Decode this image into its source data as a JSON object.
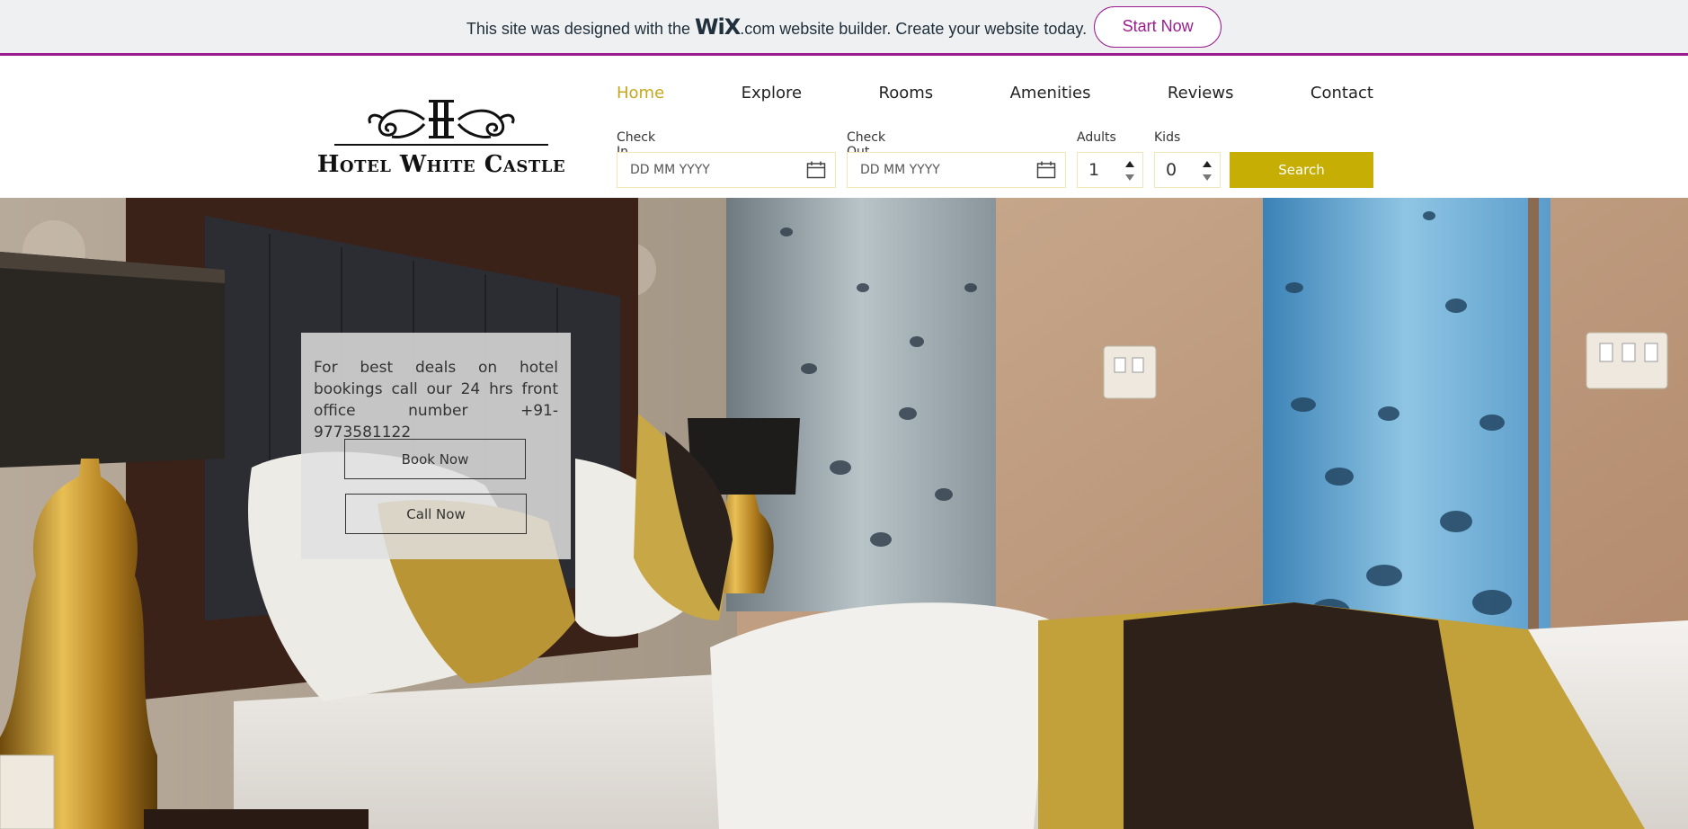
{
  "wix_banner": {
    "prefix": "This site was designed with the",
    "logo": "WiX",
    "logo_suffix": ".com",
    "suffix": "website builder. Create your website today.",
    "start_label": "Start Now",
    "accent_color": "#9b1b8e"
  },
  "logo": {
    "text": "Hotel White Castle"
  },
  "nav": {
    "items": [
      {
        "label": "Home",
        "active": true
      },
      {
        "label": "Explore"
      },
      {
        "label": "Rooms"
      },
      {
        "label": "Amenities"
      },
      {
        "label": "Reviews"
      },
      {
        "label": "Contact"
      }
    ],
    "active_color": "#c6a820"
  },
  "booking": {
    "check_in": {
      "label": "Check In",
      "placeholder": "DD MM YYYY"
    },
    "check_out": {
      "label": "Check Out",
      "placeholder": "DD MM YYYY"
    },
    "adults": {
      "label": "Adults",
      "value": "1"
    },
    "kids": {
      "label": "Kids",
      "value": "0"
    },
    "search_label": "Search",
    "button_color": "#c6ae05"
  },
  "promo": {
    "text": "For best deals on hotel bookings call our 24 hrs front office number +91-9773581122",
    "book_label": "Book Now",
    "call_label": "Call Now"
  }
}
